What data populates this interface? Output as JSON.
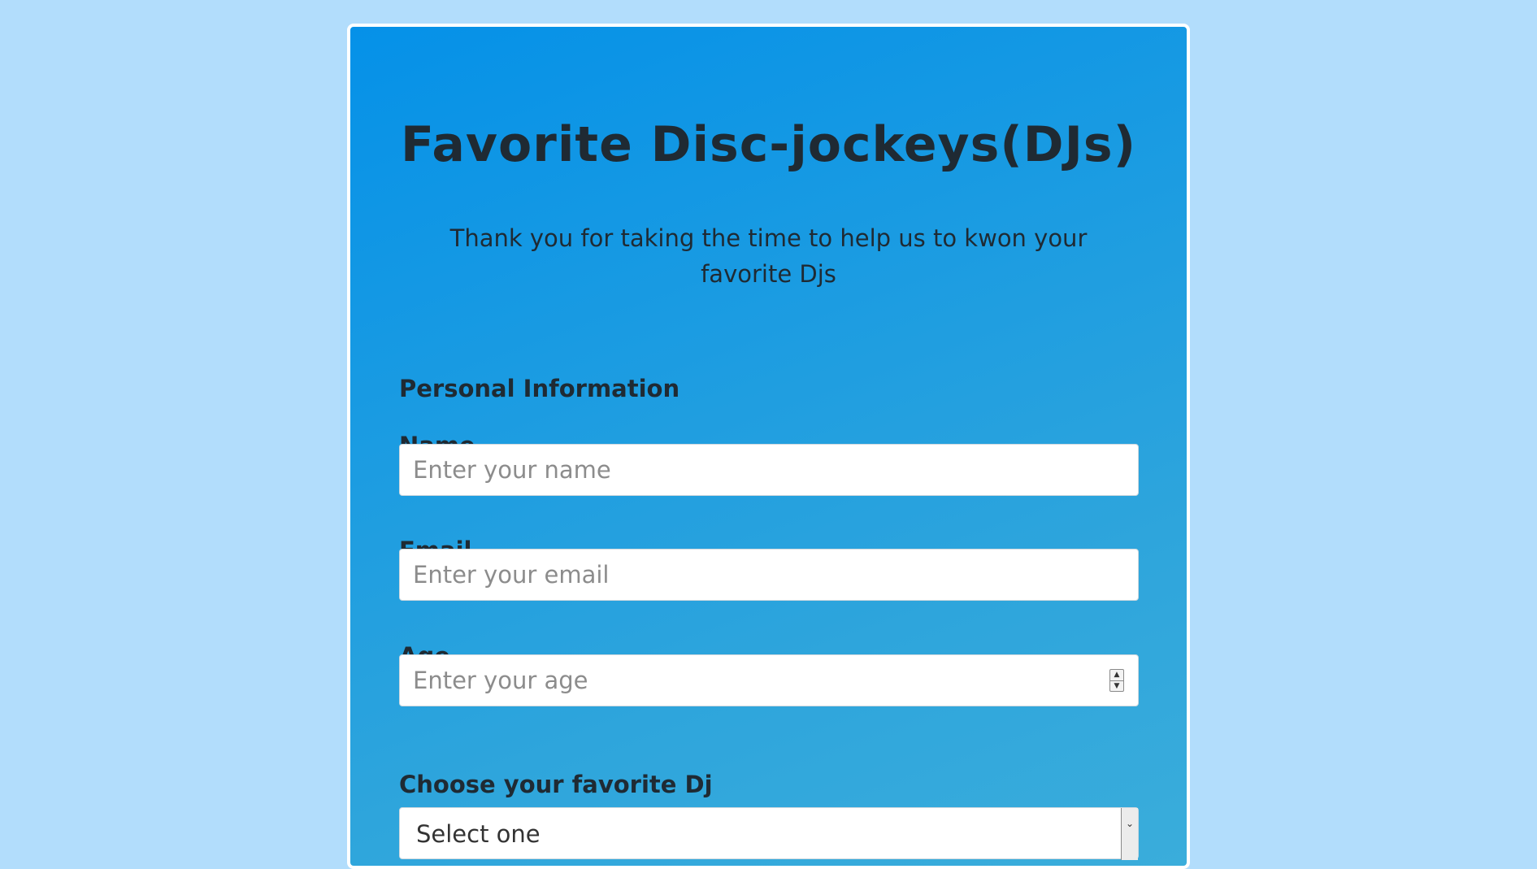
{
  "header": {
    "title": "Favorite Disc-jockeys(DJs)",
    "description": "Thank you for taking the time to help us to kwon your favorite Djs"
  },
  "personal_info": {
    "heading": "Personal Information",
    "name": {
      "label": "Name",
      "placeholder": "Enter your name",
      "value": ""
    },
    "email": {
      "label": "Email",
      "placeholder": "Enter your email",
      "value": ""
    },
    "age": {
      "label": "Age",
      "placeholder": "Enter your age",
      "value": ""
    }
  },
  "dj_choice": {
    "heading": "Choose your favorite Dj",
    "select": {
      "selected": "Select one"
    }
  },
  "colors": {
    "page_background": "#b2ddfc",
    "card_gradient_start": "#0591e8",
    "card_gradient_end": "#3aaddb",
    "text": "#1f2a33"
  }
}
